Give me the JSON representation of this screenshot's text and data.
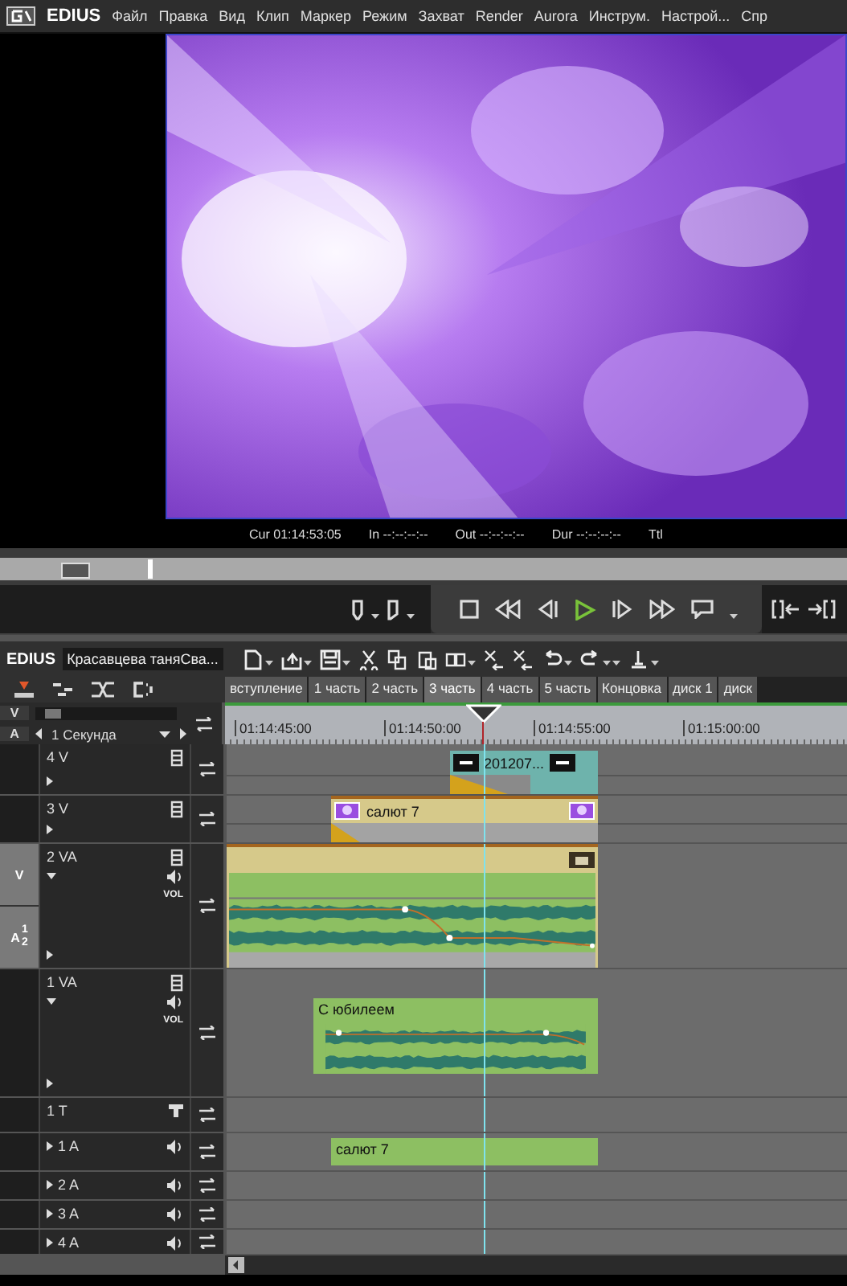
{
  "menu_bar": {
    "logo": "EDIUS",
    "items": [
      "Файл",
      "Правка",
      "Вид",
      "Клип",
      "Маркер",
      "Режим",
      "Захват",
      "Render",
      "Aurora",
      "Инструм.",
      "Настрой...",
      "Спр"
    ]
  },
  "timecode_bar": [
    {
      "label": "Cur",
      "value": "01:14:53:05"
    },
    {
      "label": "In",
      "value": "--:--:--:--"
    },
    {
      "label": "Out",
      "value": "--:--:--:--"
    },
    {
      "label": "Dur",
      "value": "--:--:--:--"
    },
    {
      "label": "Ttl"
    }
  ],
  "timeline": {
    "app_label": "EDIUS",
    "sequence_name": "Красавцева таняСва...",
    "tabs": [
      {
        "label": "вступление",
        "selected": false
      },
      {
        "label": "1 часть",
        "selected": false
      },
      {
        "label": "2 часть",
        "selected": false
      },
      {
        "label": "3 часть",
        "selected": true
      },
      {
        "label": "4 часть",
        "selected": false
      },
      {
        "label": "5 часть",
        "selected": false
      },
      {
        "label": "Концовка",
        "selected": false
      },
      {
        "label": "диск 1",
        "selected": false
      },
      {
        "label": "диск",
        "selected": false
      }
    ],
    "patch_labels": [
      "V",
      "A"
    ],
    "zoom_label": "1 Секунда",
    "zoom_slider": {
      "level": 0.05
    },
    "ruler_labels": [
      "01:14:45:00",
      "01:14:50:00",
      "01:14:55:00",
      "01:15:00:00"
    ],
    "tracks": [
      {
        "name": "4 V",
        "kind": "v",
        "clips": [
          {
            "kind": "title",
            "label": "201207..."
          }
        ]
      },
      {
        "name": "3 V",
        "kind": "v",
        "clips": [
          {
            "kind": "video",
            "label": "салют 7"
          }
        ]
      },
      {
        "name": "2 VA",
        "kind": "va",
        "volume_label": "VOL",
        "patch": {
          "video": "V",
          "audio": "A",
          "channels": [
            "1",
            "2"
          ]
        },
        "clips": [
          {
            "kind": "av"
          }
        ]
      },
      {
        "name": "1 VA",
        "kind": "va",
        "volume_label": "VOL",
        "clips": [
          {
            "kind": "audio_wave",
            "label": "С юбилеем"
          }
        ]
      },
      {
        "name": "1 T",
        "kind": "t"
      },
      {
        "name": "1 A",
        "kind": "a",
        "clips": [
          {
            "kind": "audio",
            "label": "салют 7"
          }
        ]
      },
      {
        "name": "2 A",
        "kind": "a"
      },
      {
        "name": "3 A",
        "kind": "a"
      },
      {
        "name": "4 A",
        "kind": "a"
      }
    ]
  }
}
